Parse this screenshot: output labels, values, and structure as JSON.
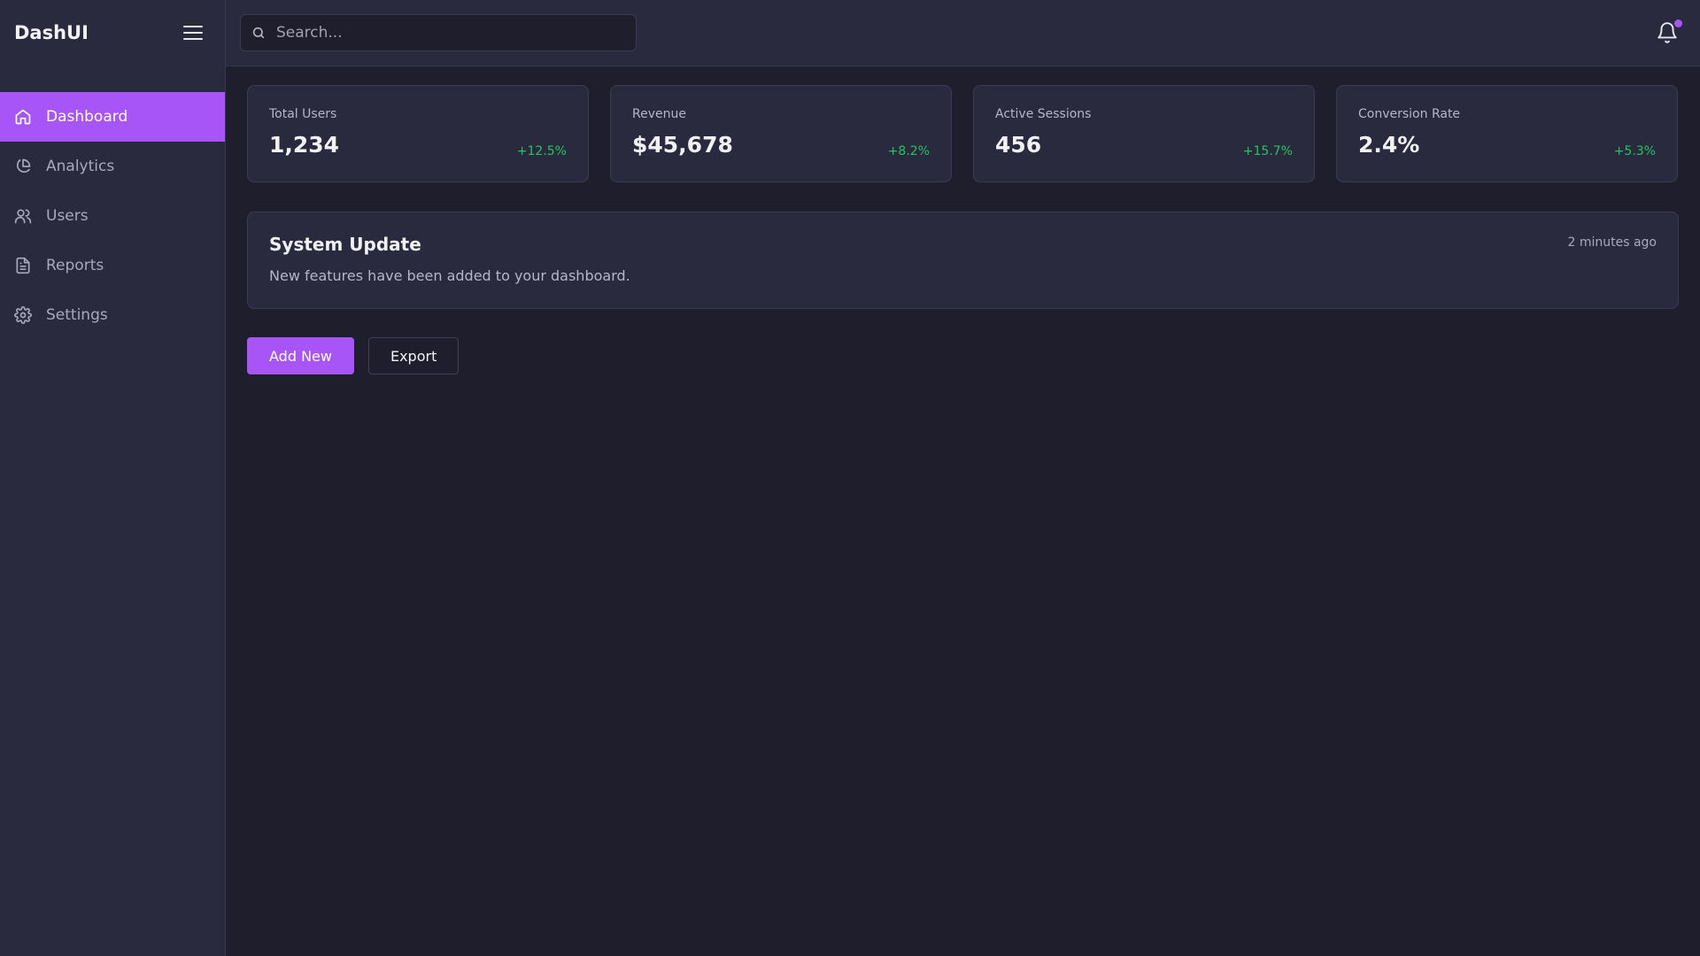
{
  "app": {
    "brand": "DashUI"
  },
  "colors": {
    "accent": "#a855f7",
    "positive": "#22c55e",
    "sidebar_bg": "#2a2a3f",
    "page_bg": "#1f1e2d"
  },
  "sidebar": {
    "menu_icon": "hamburger-menu-icon",
    "items": [
      {
        "label": "Dashboard",
        "icon": "home-icon",
        "active": true
      },
      {
        "label": "Analytics",
        "icon": "pie-chart-icon",
        "active": false
      },
      {
        "label": "Users",
        "icon": "users-icon",
        "active": false
      },
      {
        "label": "Reports",
        "icon": "document-icon",
        "active": false
      },
      {
        "label": "Settings",
        "icon": "gear-icon",
        "active": false
      }
    ]
  },
  "topbar": {
    "search": {
      "placeholder": "Search...",
      "value": "",
      "icon": "search-icon"
    },
    "notifications": {
      "icon": "bell-icon",
      "has_unread": true
    }
  },
  "stats": [
    {
      "label": "Total Users",
      "value": "1,234",
      "change": "+12.5%"
    },
    {
      "label": "Revenue",
      "value": "$45,678",
      "change": "+8.2%"
    },
    {
      "label": "Active Sessions",
      "value": "456",
      "change": "+15.7%"
    },
    {
      "label": "Conversion Rate",
      "value": "2.4%",
      "change": "+5.3%"
    }
  ],
  "notice": {
    "title": "System Update",
    "body": "New features have been added to your dashboard.",
    "time": "2 minutes ago"
  },
  "actions": {
    "primary_label": "Add New",
    "secondary_label": "Export"
  }
}
